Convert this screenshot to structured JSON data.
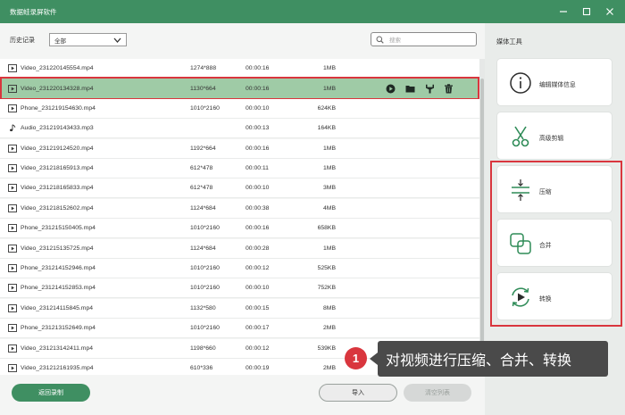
{
  "window": {
    "title": "数据蛙录屏软件"
  },
  "toolbar": {
    "history_label": "历史记录",
    "filter_value": "全部",
    "search_placeholder": "搜索"
  },
  "files": [
    {
      "name": "Video_231220145554.mp4",
      "type": "video",
      "resolution": "1274*888",
      "duration": "00:00:16",
      "size": "1MB"
    },
    {
      "name": "Video_231220134328.mp4",
      "type": "video",
      "resolution": "1130*664",
      "duration": "00:00:16",
      "size": "1MB",
      "selected": true
    },
    {
      "name": "Phone_231219154630.mp4",
      "type": "video",
      "resolution": "1010*2160",
      "duration": "00:00:10",
      "size": "624KB"
    },
    {
      "name": "Audio_231219143433.mp3",
      "type": "audio",
      "resolution": "",
      "duration": "00:00:13",
      "size": "164KB"
    },
    {
      "name": "Video_231219124520.mp4",
      "type": "video",
      "resolution": "1192*664",
      "duration": "00:00:16",
      "size": "1MB"
    },
    {
      "name": "Video_231218165913.mp4",
      "type": "video",
      "resolution": "612*478",
      "duration": "00:00:11",
      "size": "1MB"
    },
    {
      "name": "Video_231218165833.mp4",
      "type": "video",
      "resolution": "612*478",
      "duration": "00:00:10",
      "size": "3MB"
    },
    {
      "name": "Video_231218152602.mp4",
      "type": "video",
      "resolution": "1124*684",
      "duration": "00:00:38",
      "size": "4MB"
    },
    {
      "name": "Phone_231215150405.mp4",
      "type": "video",
      "resolution": "1010*2160",
      "duration": "00:00:16",
      "size": "658KB"
    },
    {
      "name": "Video_231215135725.mp4",
      "type": "video",
      "resolution": "1124*684",
      "duration": "00:00:28",
      "size": "1MB"
    },
    {
      "name": "Phone_231214152946.mp4",
      "type": "video",
      "resolution": "1010*2160",
      "duration": "00:00:12",
      "size": "525KB"
    },
    {
      "name": "Phone_231214152853.mp4",
      "type": "video",
      "resolution": "1010*2160",
      "duration": "00:00:10",
      "size": "752KB"
    },
    {
      "name": "Video_231214115845.mp4",
      "type": "video",
      "resolution": "1132*580",
      "duration": "00:00:15",
      "size": "8MB"
    },
    {
      "name": "Phone_231213152649.mp4",
      "type": "video",
      "resolution": "1010*2160",
      "duration": "00:00:17",
      "size": "2MB"
    },
    {
      "name": "Video_231213142411.mp4",
      "type": "video",
      "resolution": "1198*660",
      "duration": "00:00:12",
      "size": "539KB"
    },
    {
      "name": "Video_231212161935.mp4",
      "type": "video",
      "resolution": "610*336",
      "duration": "00:00:19",
      "size": "2MB"
    }
  ],
  "row_actions": [
    "play-icon",
    "folder-icon",
    "wrench-icon",
    "trash-icon"
  ],
  "sidebar": {
    "title": "媒体工具",
    "tools": [
      {
        "label": "编辑媒体信息",
        "icon": "info-icon"
      },
      {
        "label": "高级剪辑",
        "icon": "scissors-icon"
      },
      {
        "label": "压缩",
        "icon": "compress-icon"
      },
      {
        "label": "合并",
        "icon": "merge-icon"
      },
      {
        "label": "转换",
        "icon": "convert-icon"
      }
    ]
  },
  "footer": {
    "back_label": "返回录制",
    "import_label": "导入",
    "clear_label": "清空列表"
  },
  "callout": {
    "number": "1",
    "text": "对视频进行压缩、合并、转换"
  },
  "colors": {
    "brand_green": "#3f8f62",
    "selected_row": "#9fcba6",
    "highlight_red": "#d9363e",
    "callout_bg": "#4a4a4a"
  }
}
